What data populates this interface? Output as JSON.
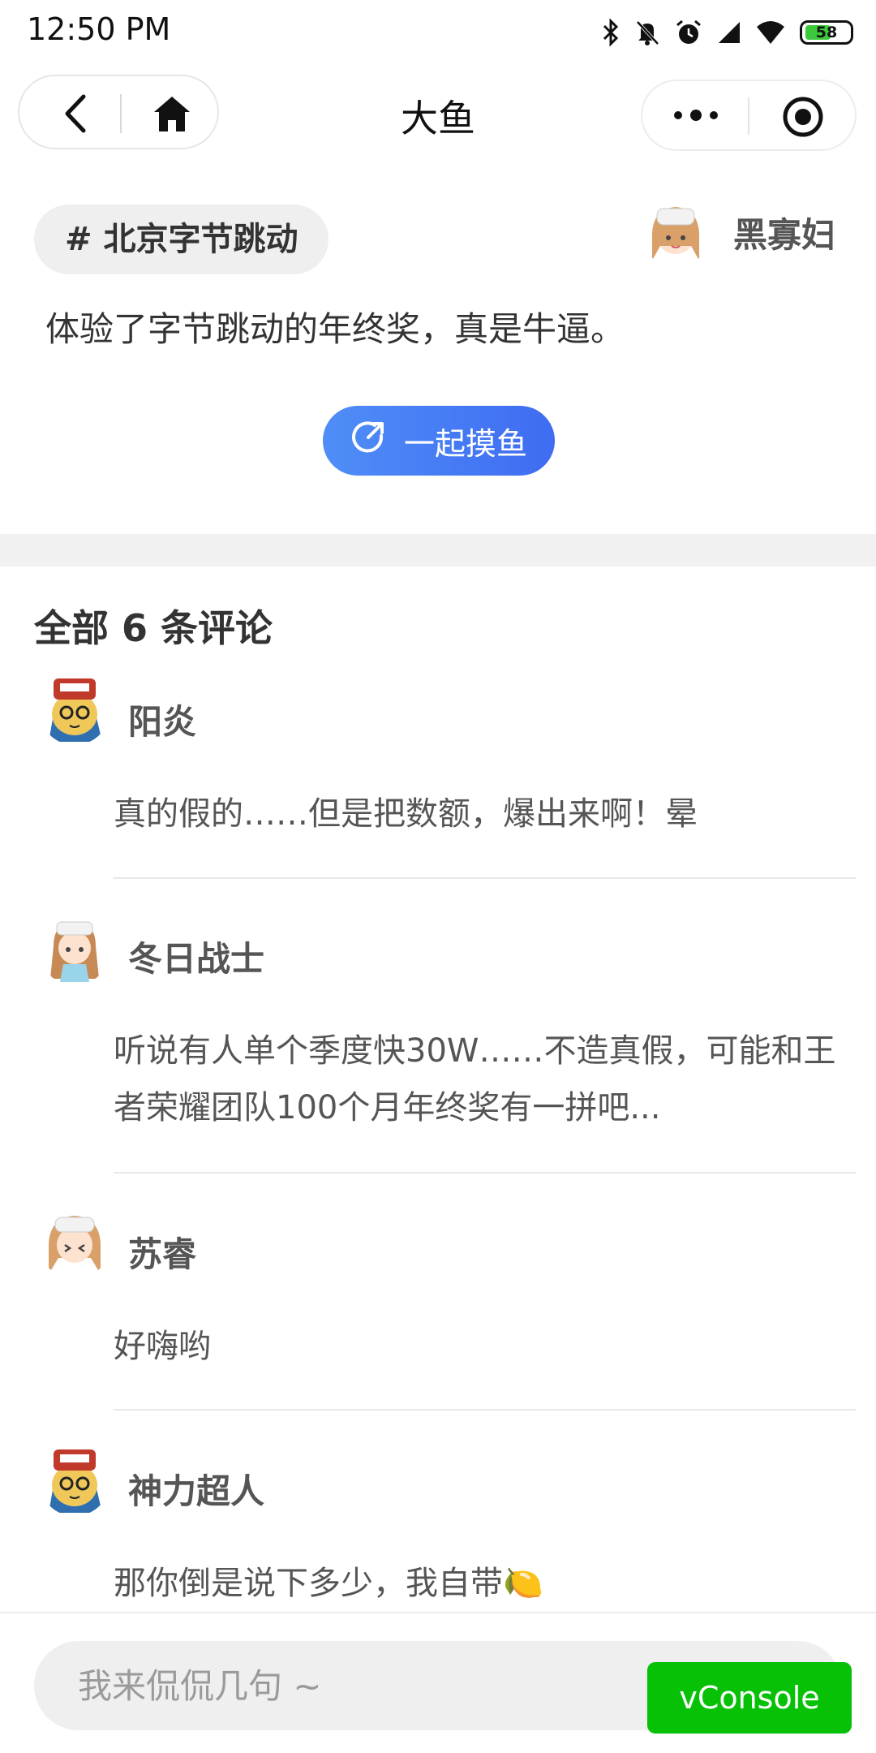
{
  "status_bar": {
    "time": "12:50 PM",
    "battery": "58",
    "icons": [
      "bluetooth-icon",
      "mute-icon",
      "alarm-icon",
      "signal-icon",
      "wifi-icon",
      "battery-icon"
    ]
  },
  "nav": {
    "title": "大鱼",
    "icons": [
      "back-icon",
      "home-icon",
      "more-icon",
      "target-icon"
    ]
  },
  "post": {
    "topic": "# 北京字节跳动",
    "author": "黑寡妇",
    "text": "体验了字节跳动的年终奖，真是牛逼。",
    "share_button": "一起摸鱼"
  },
  "comments": {
    "title": "全部 6 条评论",
    "items": [
      {
        "name": "阳炎",
        "text": "真的假的……但是把数额，爆出来啊！晕"
      },
      {
        "name": "冬日战士",
        "text": "听说有人单个季度快30W……不造真假，可能和王者荣耀团队100个月年终奖有一拼吧..."
      },
      {
        "name": "苏睿",
        "text": "好嗨哟"
      },
      {
        "name": "神力超人",
        "text": "那你倒是说下多少，我自带🍋"
      }
    ]
  },
  "bottom": {
    "input_placeholder": "我来侃侃几句 ~",
    "vconsole": "vConsole"
  },
  "colors": {
    "accent": "#4a7ff5",
    "vconsole": "#07c107",
    "band": "#f1f1f1"
  }
}
